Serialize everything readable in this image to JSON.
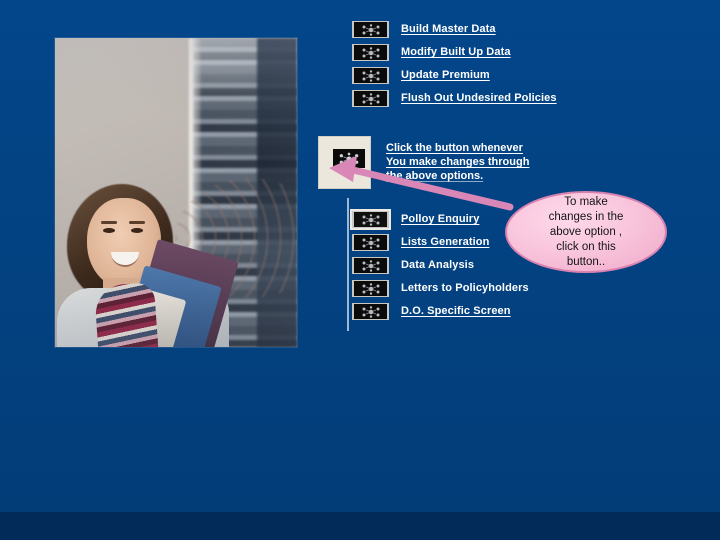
{
  "slide": {
    "background_color": "#034180",
    "bottom_band_color": "#032b5a"
  },
  "photo": {
    "alt_label": "student-holding-books-in-library-photo"
  },
  "menu_primary": {
    "items": [
      {
        "label": "Build Master Data",
        "icon": "network-node-icon",
        "underlined": true,
        "selected": false
      },
      {
        "label": "Modify Built Up Data",
        "icon": "network-node-icon",
        "underlined": true,
        "selected": false
      },
      {
        "label": "Update Premium",
        "icon": "network-node-icon",
        "underlined": true,
        "selected": false
      },
      {
        "label": "Flush Out Undesired Policies",
        "icon": "network-node-icon",
        "underlined": true,
        "selected": false
      }
    ]
  },
  "menu_secondary": {
    "items": [
      {
        "label": "Polloy Enquiry",
        "icon": "network-node-icon",
        "underlined": true,
        "selected": true
      },
      {
        "label": "Lists Generation",
        "icon": "network-node-icon",
        "underlined": true,
        "selected": false
      },
      {
        "label": "Data Analysis",
        "icon": "network-node-icon",
        "underlined": false,
        "selected": false
      },
      {
        "label": "Letters to Policyholders",
        "icon": "network-node-icon",
        "underlined": false,
        "selected": false
      },
      {
        "label": "D.O. Specific Screen",
        "icon": "network-node-icon",
        "underlined": true,
        "selected": false
      }
    ]
  },
  "action_button": {
    "icon": "network-node-icon",
    "panel_color": "#ece7dc"
  },
  "instruction": {
    "line1": "Click the button whenever",
    "line2": "You make changes through",
    "line3": "the above options."
  },
  "callout": {
    "arrow_color": "#d987b6",
    "bubble_fill": "#f9c6dd",
    "bubble_border": "#d982b0",
    "line1": "To make",
    "line2": "changes in  the",
    "line3": "above option ,",
    "line4": "click on this",
    "line5": "button.."
  }
}
